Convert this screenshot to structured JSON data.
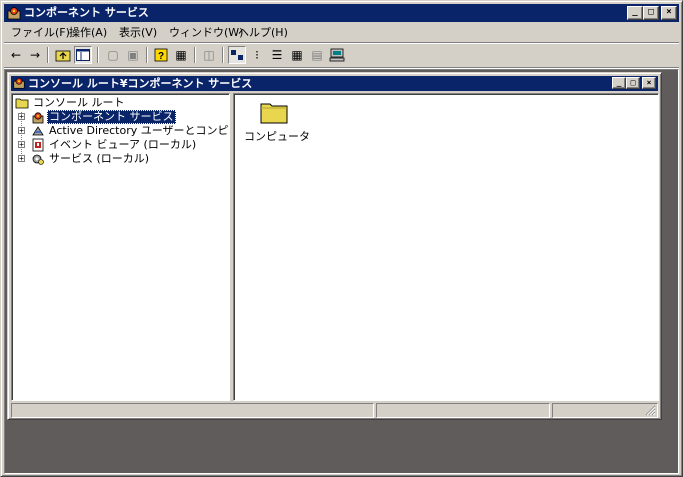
{
  "window": {
    "title": "コンポーネント サービス",
    "caption_buttons": [
      "_",
      "□",
      "×"
    ]
  },
  "menubar": {
    "items": [
      "ファイル(F)",
      "操作(A)",
      "表示(V)",
      "ウィンドウ(W)",
      "ヘルプ(H)"
    ]
  },
  "toolbar": {
    "buttons": [
      {
        "name": "back-icon",
        "glyph": "←"
      },
      {
        "name": "forward-icon",
        "glyph": "→"
      },
      {
        "name": "up-folder-icon",
        "glyph": "⇡"
      },
      {
        "name": "show-hide-tree-icon",
        "glyph": "▤"
      },
      {
        "name": "properties-icon",
        "glyph": "▢"
      },
      {
        "name": "export-list-icon",
        "glyph": "▣"
      },
      {
        "name": "help-icon",
        "glyph": "?"
      },
      {
        "name": "action-icon",
        "glyph": "▦"
      },
      {
        "name": "new-window-icon",
        "glyph": "◫"
      },
      {
        "name": "large-icons-icon",
        "glyph": "▚"
      },
      {
        "name": "small-icons-icon",
        "glyph": "⁝"
      },
      {
        "name": "list-view-icon",
        "glyph": "☰"
      },
      {
        "name": "detail-view-icon",
        "glyph": "▦"
      },
      {
        "name": "status-view-icon",
        "glyph": "▤"
      },
      {
        "name": "computer-icon",
        "glyph": "▣"
      }
    ]
  },
  "child_window": {
    "title": "コンソール ルート¥コンポーネント サービス",
    "caption_buttons": [
      "_",
      "□",
      "×"
    ]
  },
  "tree": {
    "root": "コンソール ルート",
    "items": [
      {
        "label": "コンポーネント サービス",
        "selected": true
      },
      {
        "label": "Active Directory ユーザーとコンピュータ",
        "selected": false
      },
      {
        "label": "イベント ビューア (ローカル)",
        "selected": false
      },
      {
        "label": "サービス (ローカル)",
        "selected": false
      }
    ]
  },
  "content": {
    "items": [
      {
        "label": "コンピュータ"
      }
    ]
  },
  "colors": {
    "titlebar": "#0a246a",
    "face": "#d4d0c8",
    "mdi_bg": "#5f5c5b",
    "folder": "#e8d74e"
  }
}
